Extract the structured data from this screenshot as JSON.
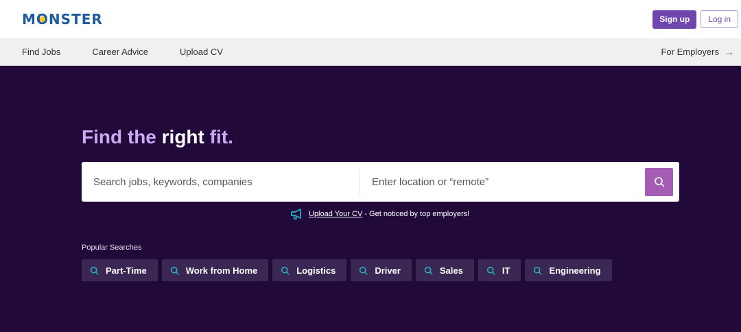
{
  "header": {
    "logo_text": "MONSTER",
    "signup_label": "Sign up",
    "login_label": "Log in"
  },
  "nav": {
    "items": [
      {
        "label": "Find Jobs"
      },
      {
        "label": "Career Advice"
      },
      {
        "label": "Upload CV"
      }
    ],
    "employers_label": "For Employers"
  },
  "hero": {
    "title_part1": "Find the ",
    "title_strong": "right",
    "title_part2": " fit.",
    "search_placeholder": "Search jobs, keywords, companies",
    "location_placeholder": "Enter location or “remote”",
    "upload_link": "Upload Your CV",
    "upload_suffix": " - Get noticed by top employers!",
    "popular_label": "Popular Searches",
    "popular": [
      "Part-Time",
      "Work from Home",
      "Logistics",
      "Driver",
      "Sales",
      "IT",
      "Engineering"
    ]
  },
  "colors": {
    "brand_purple": "#6e46ae",
    "hero_bg": "#21093a",
    "search_button": "#a55cb4",
    "accent_teal": "#2bb5c9"
  },
  "icons": {
    "search": "search-icon",
    "megaphone": "megaphone-icon",
    "arrow": "arrow-right-icon"
  }
}
